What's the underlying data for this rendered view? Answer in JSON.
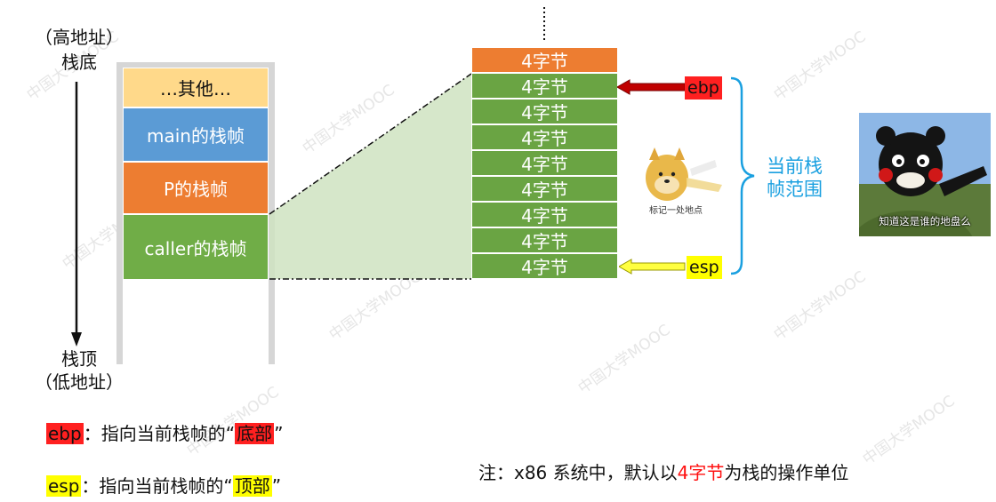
{
  "left_labels": {
    "high_addr": "（高地址）",
    "stack_bottom": "栈底",
    "stack_top": "栈顶",
    "low_addr": "（低地址）"
  },
  "stack_blocks": [
    {
      "label": "…其他…",
      "color": "#ffd98a",
      "text_color": "#111111"
    },
    {
      "label": "main的栈帧",
      "color": "#5b9bd5",
      "text_color": "#ffffff"
    },
    {
      "label": "P的栈帧",
      "color": "#ed7d31",
      "text_color": "#ffffff"
    },
    {
      "label": "caller的栈帧",
      "color": "#70ad47",
      "text_color": "#ffffff"
    }
  ],
  "frame_cells": [
    {
      "label": "4字节",
      "color": "#ed7d31"
    },
    {
      "label": "4字节",
      "color": "#6aa443"
    },
    {
      "label": "4字节",
      "color": "#6aa443"
    },
    {
      "label": "4字节",
      "color": "#6aa443"
    },
    {
      "label": "4字节",
      "color": "#6aa443"
    },
    {
      "label": "4字节",
      "color": "#6aa443"
    },
    {
      "label": "4字节",
      "color": "#6aa443"
    },
    {
      "label": "4字节",
      "color": "#6aa443"
    },
    {
      "label": "4字节",
      "color": "#6aa443"
    }
  ],
  "pointers": {
    "ebp": {
      "label": "ebp",
      "color": "#ff2020"
    },
    "esp": {
      "label": "esp",
      "color": "#ffff00"
    }
  },
  "brace_label": "当前栈\n帧范围",
  "doge_caption": "标记一处地点",
  "meme_caption": "知道这是谁的地盘么",
  "legend": {
    "ebp_key": "ebp",
    "ebp_text": "：指向当前栈帧的“",
    "ebp_highlight": "底部",
    "ebp_close": "”",
    "esp_key": "esp",
    "esp_text": "：指向当前栈帧的“",
    "esp_highlight": "顶部",
    "esp_close": "”"
  },
  "note": {
    "prefix": "注：x86 系统中，默认以",
    "highlight": "4字节",
    "suffix": "为栈的操作单位"
  },
  "colors": {
    "accent_blue": "#1aa0e0",
    "highlight_red": "#ff1010"
  }
}
